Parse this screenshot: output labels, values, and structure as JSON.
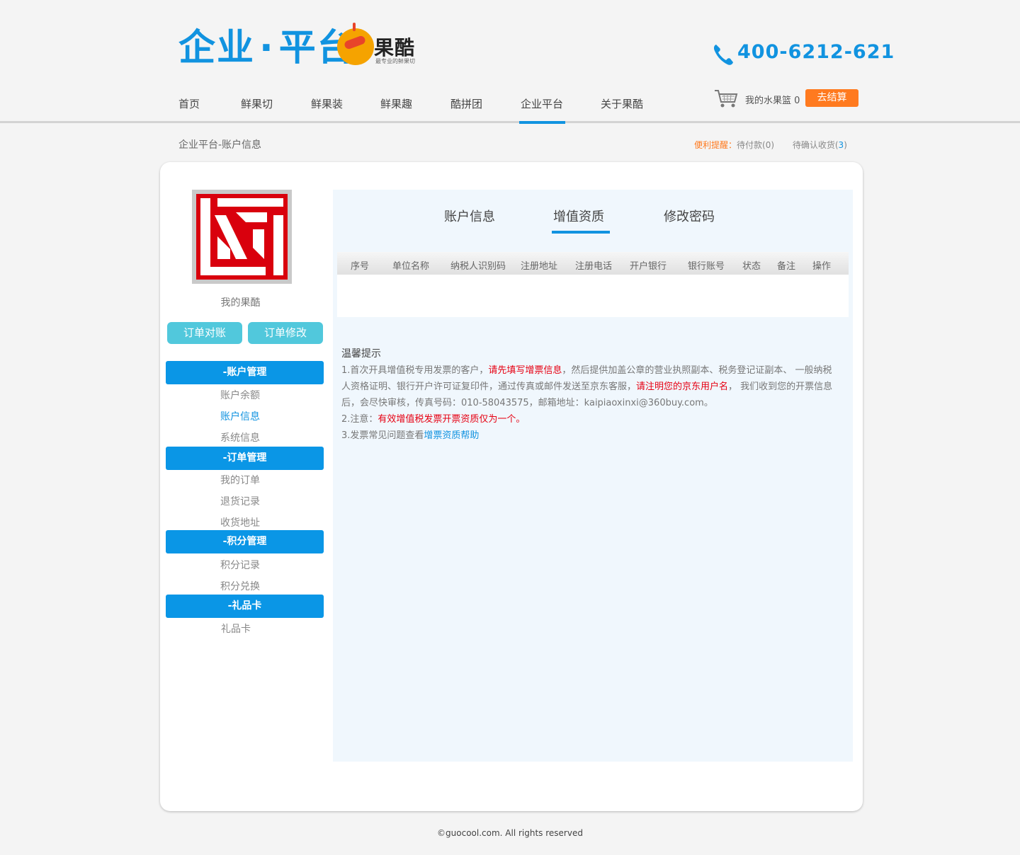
{
  "header": {
    "logo_text_a": "企业",
    "logo_dot": "·",
    "logo_text_b": "平台",
    "brand_name": "果酷",
    "brand_sub": "最专业的鲜果切",
    "phone": "400-6212-621"
  },
  "nav": {
    "items": [
      "首页",
      "鲜果切",
      "鲜果装",
      "鲜果趣",
      "酷拼团",
      "企业平台",
      "关于果酷"
    ],
    "active": "企业平台"
  },
  "cart": {
    "label": "我的水果篮",
    "count": "0",
    "checkout": "去结算"
  },
  "breadcrumb": "企业平台-账户信息",
  "reminder": {
    "label": "便利提醒：",
    "pending_pay_label": "待付款(",
    "pending_pay_count": "0",
    "pending_pay_close": ")",
    "pending_receive_label": "待确认收货(",
    "pending_receive_count": "3",
    "pending_receive_close": ")"
  },
  "sidebar": {
    "avatar_label": "我的果酷",
    "btn_reconcile": "订单对账",
    "btn_modify": "订单修改",
    "sections": [
      {
        "title": "-账户管理",
        "links": [
          "账户余额",
          "账户信息",
          "系统信息"
        ]
      },
      {
        "title": "-订单管理",
        "links": [
          "我的订单",
          "退货记录",
          "收货地址"
        ]
      },
      {
        "title": "-积分管理",
        "links": [
          "积分记录",
          "积分兑换"
        ]
      },
      {
        "title": "-礼品卡",
        "links": [
          "礼品卡"
        ]
      }
    ],
    "active_link": "账户信息"
  },
  "tabs": [
    "账户信息",
    "增值资质",
    "修改密码"
  ],
  "active_tab": "增值资质",
  "table": {
    "columns": [
      "序号",
      "单位名称",
      "纳税人识别码",
      "注册地址",
      "注册电话",
      "开户银行",
      "银行账号",
      "状态",
      "备注",
      "操作"
    ]
  },
  "tips": {
    "title": "温馨提示",
    "p1_a": "1.首次开具增值税专用发票的客户，",
    "p1_b": "请先填写增票信息",
    "p1_c": "，然后提供加盖公章的营业执照副本、税务登记证副本、 一般纳税人资格证明、银行开户许可证复印件，通过传真或邮件发送至京东客服，",
    "p1_d": "请注明您的京东用户名",
    "p1_e": "， 我们收到您的开票信息后，会尽快审核，传真号码：010-58043575，邮箱地址：kaipiaoxinxi@360buy.com。",
    "p2_a": "2.注意：",
    "p2_b": "有效增值税发票开票资质仅为一个。",
    "p3_a": "3.发票常见问题查看",
    "p3_b": "增票资质帮助"
  },
  "footer": "©guocool.com. All rights reserved",
  "colors": {
    "primary": "#1193e0",
    "orange": "#ff7a1f",
    "teal": "#51c8dc",
    "red": "#e60012",
    "avatar_red": "#d9000d"
  }
}
